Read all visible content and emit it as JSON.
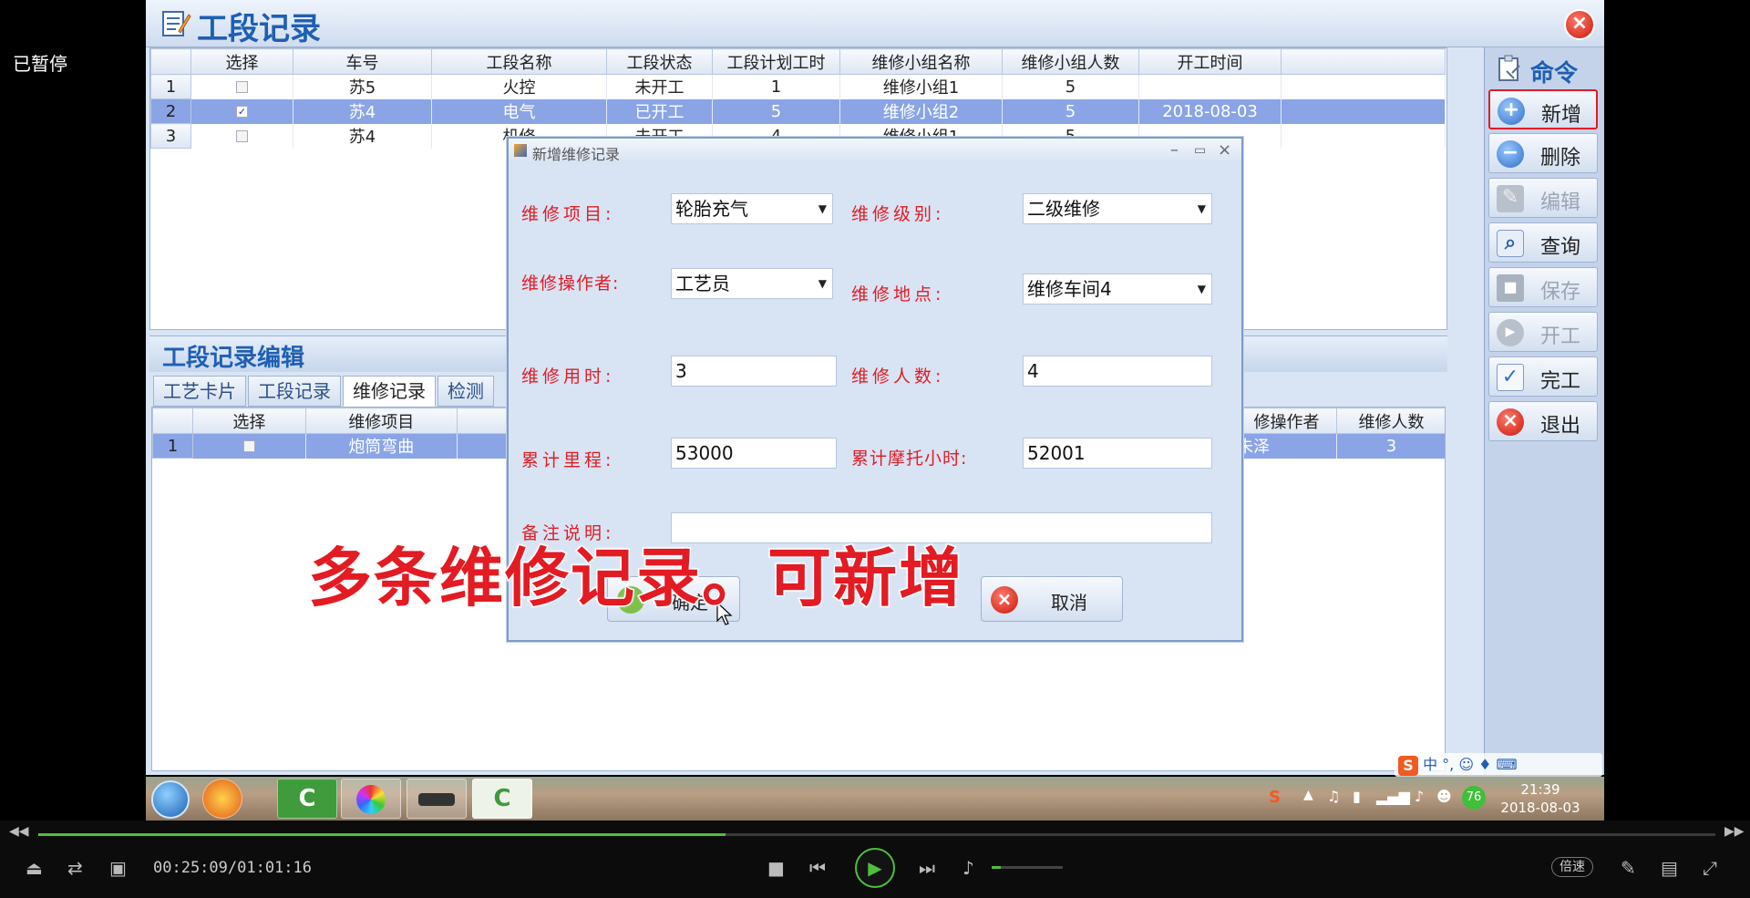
{
  "paused_text": "已暂停",
  "app": {
    "title": "工段记录",
    "close_label": "×",
    "top_grid": {
      "columns": [
        "选择",
        "车号",
        "工段名称",
        "工段状态",
        "工段计划工时",
        "维修小组名称",
        "维修小组人数",
        "开工时间"
      ],
      "rows": [
        {
          "no": "1",
          "checked": false,
          "car": "苏5",
          "section": "火控",
          "status": "未开工",
          "hours": "1",
          "group": "维修小组1",
          "count": "5",
          "start": ""
        },
        {
          "no": "2",
          "checked": true,
          "car": "苏4",
          "section": "电气",
          "status": "已开工",
          "hours": "5",
          "group": "维修小组2",
          "count": "5",
          "start": "2018-08-03"
        },
        {
          "no": "3",
          "checked": false,
          "car": "苏4",
          "section": "机修",
          "status": "未开工",
          "hours": "4",
          "group": "维修小组1",
          "count": "5",
          "start": ""
        }
      ]
    },
    "edit_title": "工段记录编辑",
    "tabs": [
      "工艺卡片",
      "工段记录",
      "维修记录",
      "检测"
    ],
    "bottom_grid": {
      "columns": [
        "选择",
        "维修项目",
        "修操作者",
        "维修人数"
      ],
      "rows": [
        {
          "no": "1",
          "item": "炮筒弯曲",
          "operator": "朱泽",
          "count": "3"
        }
      ]
    },
    "commands": {
      "title": "命令",
      "buttons": [
        {
          "label": "新增",
          "icon": "plus-icon",
          "enabled": true
        },
        {
          "label": "删除",
          "icon": "minus-icon",
          "enabled": true
        },
        {
          "label": "编辑",
          "icon": "edit-icon",
          "enabled": false
        },
        {
          "label": "查询",
          "icon": "search-icon",
          "enabled": true
        },
        {
          "label": "保存",
          "icon": "save-icon",
          "enabled": false
        },
        {
          "label": "开工",
          "icon": "play-icon",
          "enabled": false
        },
        {
          "label": "完工",
          "icon": "check-icon",
          "enabled": true
        },
        {
          "label": "退出",
          "icon": "exit-icon",
          "enabled": true
        }
      ]
    }
  },
  "dialog": {
    "title": "新增维修记录",
    "fields": {
      "item_label": "维修项目:",
      "item_value": "轮胎充气",
      "level_label": "维修级别:",
      "level_value": "二级维修",
      "operator_label": "维修操作者:",
      "operator_value": "工艺员",
      "location_label": "维修地点:",
      "location_value": "维修车间4",
      "hours_label": "维修用时:",
      "hours_value": "3",
      "people_label": "维修人数:",
      "people_value": "4",
      "mileage_label": "累计里程:",
      "mileage_value": "53000",
      "motor_label": "累计摩托小时:",
      "motor_value": "52001",
      "note_label": "备注说明:",
      "note_value": ""
    },
    "ok_label": "确定",
    "cancel_label": "取消"
  },
  "subtitle": "多条维修记录。可新增",
  "taskbar": {
    "time": "21:39",
    "date": "2018-08-03",
    "badge": "76",
    "ime": "中 °, ☺ ♦ ⌨"
  },
  "player": {
    "time": "00:25:09/01:01:16",
    "speed_label": "倍速",
    "progress": 0.41
  },
  "colors": {
    "accent_blue": "#1f5fb3",
    "selection": "#8aa4e6",
    "label_red": "#e31b23",
    "progress_green": "#4fbf3a"
  }
}
